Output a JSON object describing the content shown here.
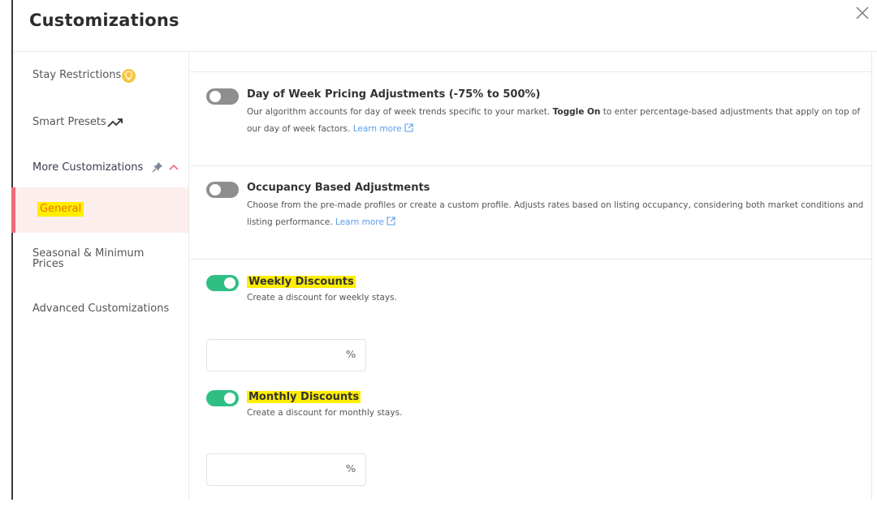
{
  "modal": {
    "title": "Customizations",
    "close_icon": "close-icon"
  },
  "sidebar": {
    "items": [
      {
        "label": "Stay Restrictions",
        "icon": "lightbulb-icon"
      },
      {
        "label": "Smart Presets",
        "icon": "trending-up-icon"
      },
      {
        "label": "More Customizations",
        "icons": [
          "pin-icon",
          "chevron-up-icon"
        ],
        "expanded": true
      },
      {
        "label": "General",
        "active": true
      },
      {
        "label": "Seasonal & Minimum Prices"
      },
      {
        "label": "Advanced Customizations"
      }
    ]
  },
  "content": {
    "day_of_week": {
      "title": "Day of Week Pricing Adjustments (-75% to 500%)",
      "desc_before": "Our algorithm accounts for day of week trends specific to your market. ",
      "desc_bold": "Toggle On",
      "desc_after": " to enter percentage-based adjustments that apply on top of our day of week factors. ",
      "learn_more": "Learn more",
      "enabled": false
    },
    "occupancy": {
      "title": "Occupancy Based Adjustments",
      "desc": "Choose from the pre-made profiles or create a custom profile. Adjusts rates based on listing occupancy, considering both market conditions and listing performance. ",
      "learn_more": "Learn more",
      "enabled": false
    },
    "weekly": {
      "title": "Weekly Discounts",
      "desc": "Create a discount for weekly stays.",
      "enabled": true,
      "value": "",
      "unit": "%"
    },
    "monthly": {
      "title": "Monthly Discounts",
      "desc": "Create a discount for monthly stays.",
      "enabled": true,
      "value": "",
      "unit": "%"
    }
  },
  "colors": {
    "toggle_on": "#2fbf85",
    "toggle_off": "#8e8e8e",
    "active_accent": "#f06a78",
    "active_bg": "#fdeeee",
    "highlight": "#ffee00",
    "link": "#5b9bea"
  }
}
